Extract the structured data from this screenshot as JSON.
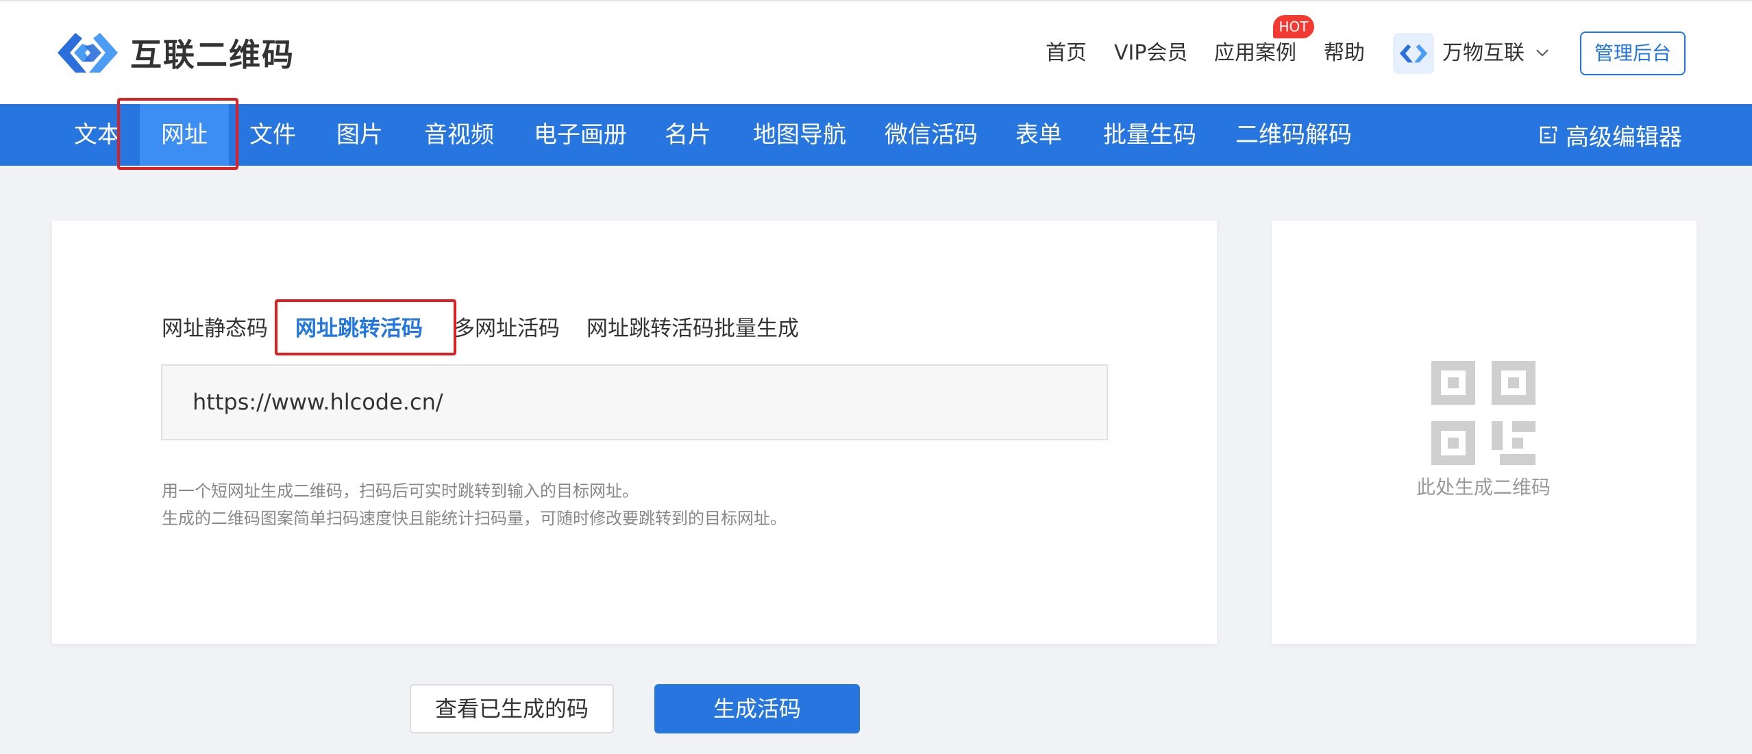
{
  "brand": {
    "name": "互联二维码"
  },
  "topnav": {
    "items": [
      {
        "label": "首页"
      },
      {
        "label": "VIP会员"
      },
      {
        "label": "应用案例",
        "badge": "HOT"
      },
      {
        "label": "帮助"
      }
    ],
    "account": {
      "name": "万物互联"
    },
    "admin_label": "管理后台"
  },
  "mainnav": {
    "items": [
      "文本",
      "网址",
      "文件",
      "图片",
      "音视频",
      "电子画册",
      "名片",
      "地图导航",
      "微信活码",
      "表单",
      "批量生码",
      "二维码解码"
    ],
    "active": "网址",
    "editor_label": "高级编辑器"
  },
  "form": {
    "tabs": [
      "网址静态码",
      "网址跳转活码",
      "多网址活码",
      "网址跳转活码批量生成"
    ],
    "active_tab": "网址跳转活码",
    "url_value": "https://www.hlcode.cn/",
    "desc_lines": [
      "用一个短网址生成二维码，扫码后可实时跳转到输入的目标网址。",
      "生成的二维码图案简单扫码速度快且能统计扫码量，可随时修改要跳转到的目标网址。"
    ]
  },
  "preview": {
    "placeholder": "此处生成二维码"
  },
  "actions": {
    "view_label": "查看已生成的码",
    "generate_label": "生成活码"
  },
  "colors": {
    "primary": "#2776e0",
    "active_nav": "#3d8ef2",
    "hot_badge": "#f23a32",
    "highlight_box": "#e02020"
  }
}
